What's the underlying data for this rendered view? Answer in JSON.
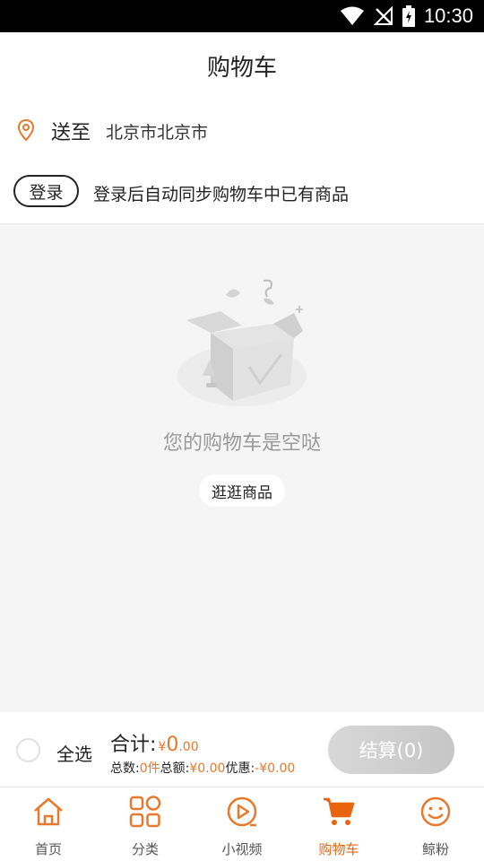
{
  "status_bar": {
    "time": "10:30"
  },
  "header": {
    "title": "购物车"
  },
  "address": {
    "label": "送至",
    "value": "北京市北京市"
  },
  "login": {
    "button_label": "登录",
    "hint": "登录后自动同步购物车中已有商品"
  },
  "empty_state": {
    "message": "您的购物车是空哒",
    "browse_label": "逛逛商品"
  },
  "checkout": {
    "select_all_label": "全选",
    "total_label": "合计:",
    "currency": "¥",
    "total_int": "0",
    "total_dec": ".00",
    "count_label": "总数:",
    "count_value": "0件",
    "amount_label": "总额:",
    "amount_value": "¥0.00",
    "discount_label": "优惠:",
    "discount_value": "-¥0.00",
    "checkout_label": "结算(0)"
  },
  "tabs": [
    {
      "label": "首页",
      "icon": "home-icon",
      "active": false
    },
    {
      "label": "分类",
      "icon": "category-icon",
      "active": false
    },
    {
      "label": "小视频",
      "icon": "video-icon",
      "active": false
    },
    {
      "label": "购物车",
      "icon": "cart-icon",
      "active": true
    },
    {
      "label": "鲸粉",
      "icon": "smile-icon",
      "active": false
    }
  ],
  "colors": {
    "accent": "#e8782b",
    "tab_active": "#e8640f",
    "background": "#f5f5f5"
  }
}
